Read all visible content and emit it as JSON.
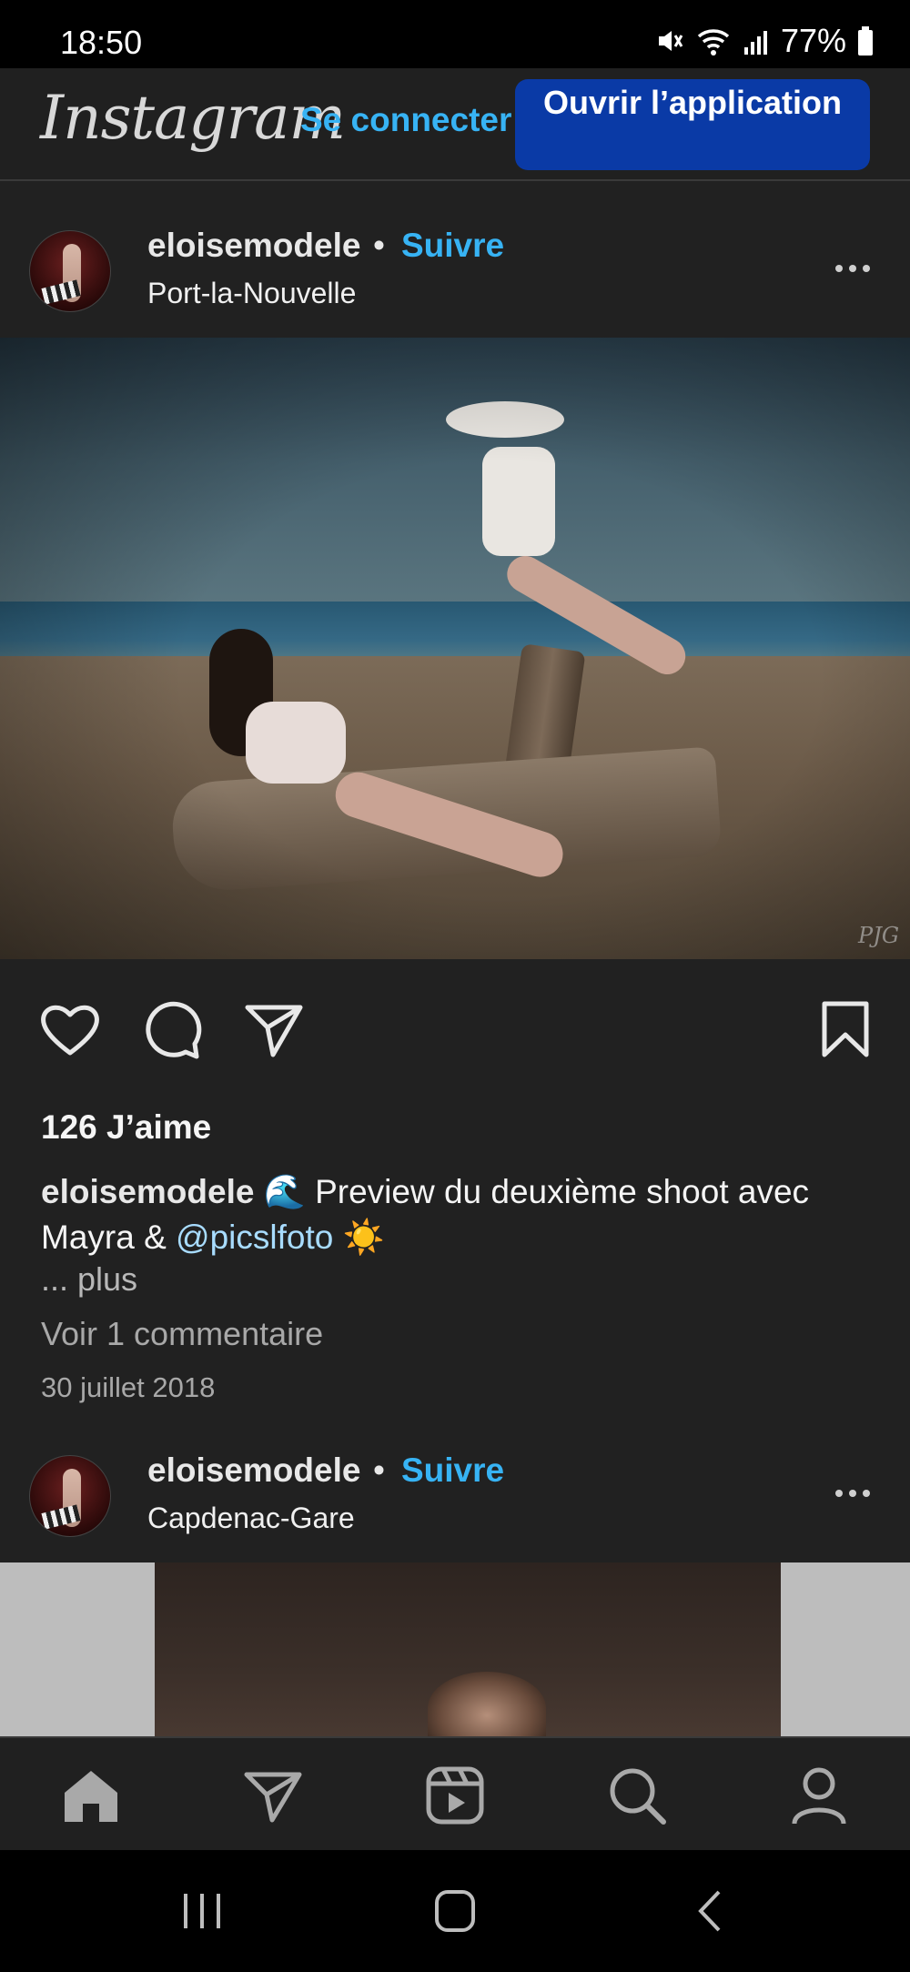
{
  "status_bar": {
    "time": "18:50",
    "battery": "77%"
  },
  "header": {
    "logo": "Instagram",
    "login": "Se connecter",
    "open_app": "Ouvrir l’application"
  },
  "posts": [
    {
      "username": "eloisemodele",
      "separator": "•",
      "follow": "Suivre",
      "location": "Port-la-Nouvelle",
      "watermark": "PJG",
      "likes": "126 J’aime",
      "caption_user": "eloisemodele",
      "caption_text_1": " 🌊 Preview du deuxième shoot avec Mayra & ",
      "caption_mention": "@picslfoto",
      "caption_text_2": " ☀️",
      "more": "... plus",
      "comments": "Voir 1 commentaire",
      "date": "30 juillet 2018"
    },
    {
      "username": "eloisemodele",
      "separator": "•",
      "follow": "Suivre",
      "location": "Capdenac-Gare"
    }
  ],
  "colors": {
    "accent": "#37b3f4",
    "button": "#0a3aa6",
    "background": "#212121"
  },
  "icons": {
    "actions": [
      "heart-icon",
      "comment-icon",
      "share-icon",
      "bookmark-icon"
    ],
    "nav": [
      "home-icon",
      "direct-icon",
      "reels-icon",
      "search-icon",
      "profile-icon"
    ],
    "system": [
      "recent-apps-icon",
      "home-button-icon",
      "back-icon"
    ]
  }
}
